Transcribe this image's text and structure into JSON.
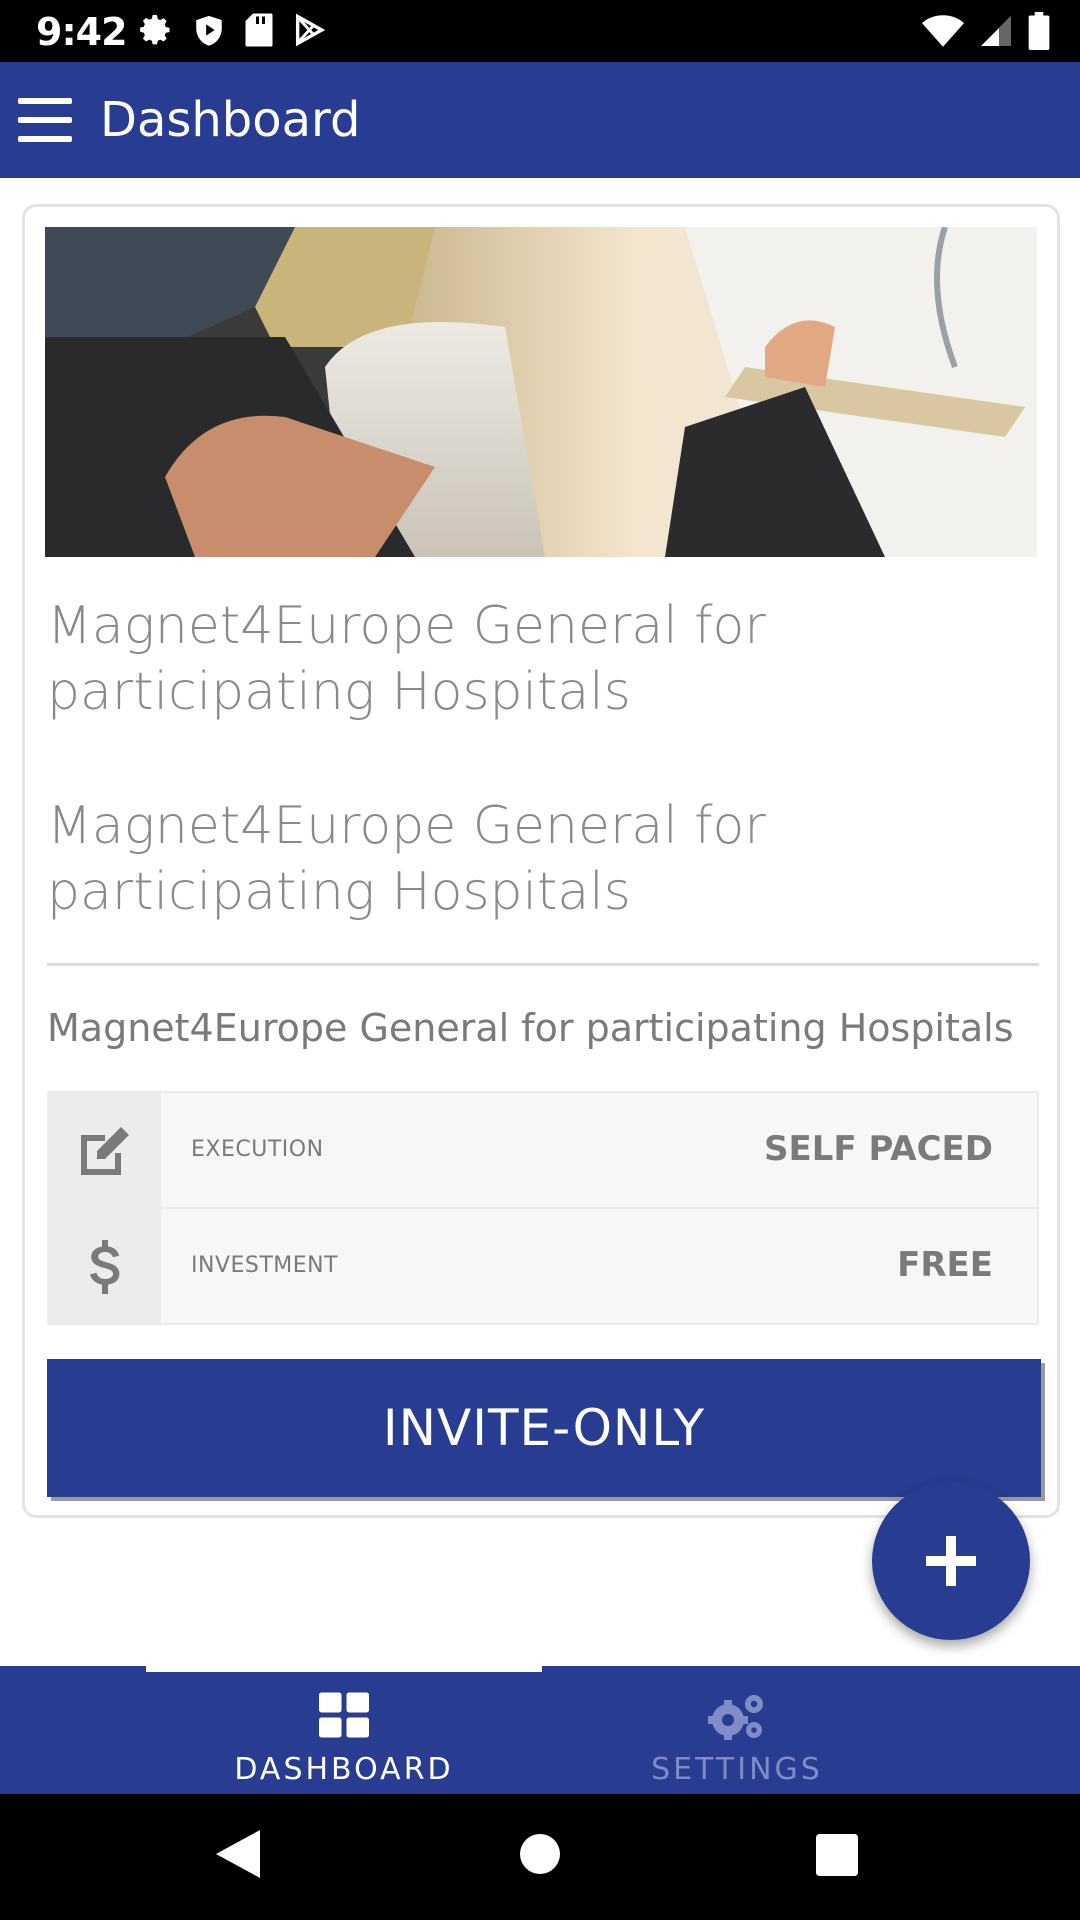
{
  "status_bar": {
    "time": "9:42",
    "left_icons": [
      "settings-icon",
      "shield-icon",
      "sd-card-icon",
      "play-store-icon"
    ],
    "right_icons": [
      "wifi-icon",
      "cell-signal-icon",
      "battery-icon"
    ]
  },
  "app_bar": {
    "title": "Dashboard",
    "menu_icon": "hamburger-menu-icon"
  },
  "course_card": {
    "image_alt": "doctor-consultation-photo",
    "title_1": "Magnet4Europe General for participating Hospitals",
    "title_2": "Magnet4Europe General for participating Hospitals",
    "description": "Magnet4Europe General for participating Hospitals",
    "info": [
      {
        "icon": "edit-icon",
        "label": "EXECUTION",
        "value": "SELF PACED"
      },
      {
        "icon": "dollar-icon",
        "label": "INVESTMENT",
        "value": "FREE"
      }
    ],
    "button_label": "INVITE-ONLY"
  },
  "fab": {
    "icon": "plus-icon"
  },
  "bottom_nav": {
    "tabs": [
      {
        "label": "DASHBOARD",
        "icon": "grid-icon",
        "active": true
      },
      {
        "label": "SETTINGS",
        "icon": "gears-icon",
        "active": false
      }
    ]
  },
  "system_nav": [
    "back-icon",
    "home-icon",
    "recents-icon"
  ],
  "colors": {
    "primary": "#283c91",
    "status_bar": "#000000",
    "muted_text": "#8a8a8a",
    "inactive_tab": "#7f8cc6"
  }
}
